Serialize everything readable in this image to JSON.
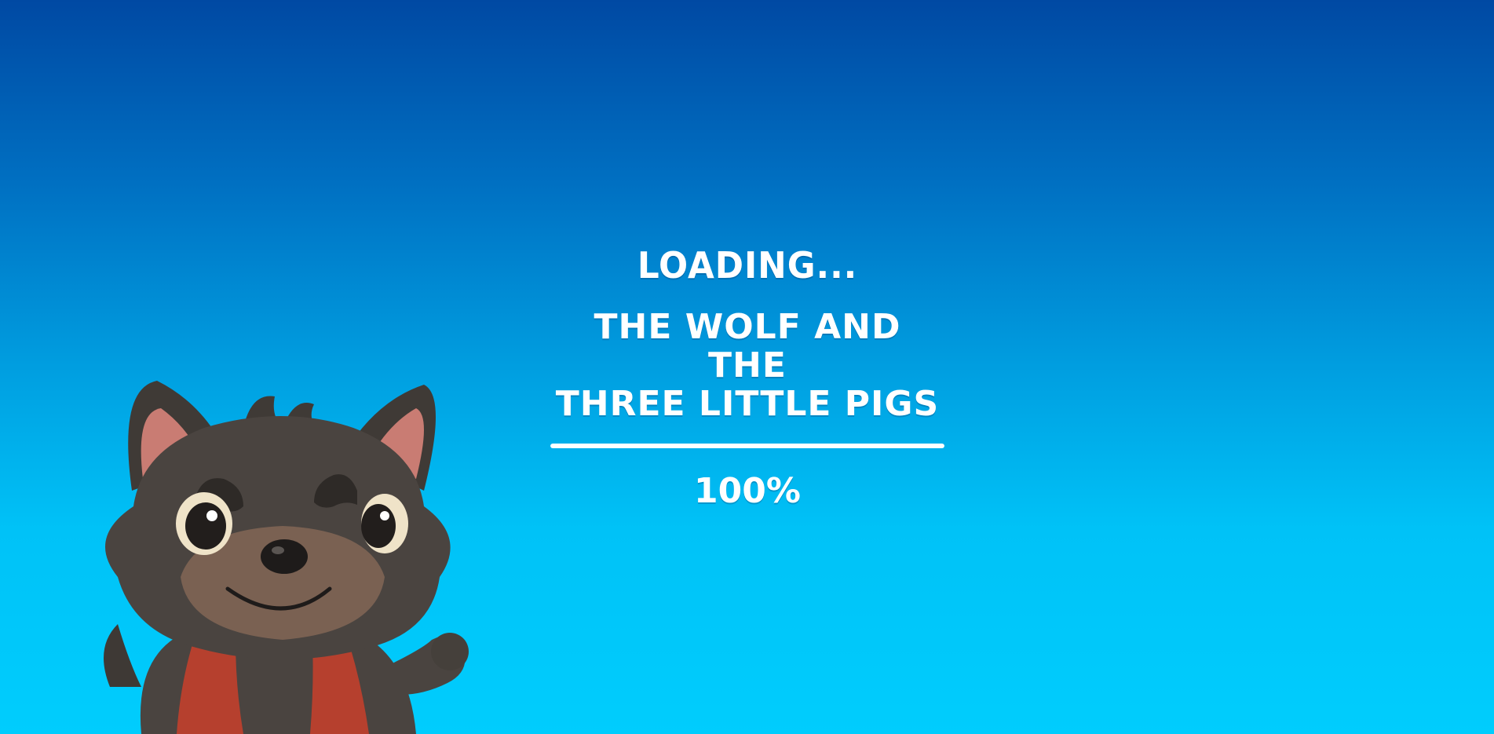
{
  "loading": {
    "label": "LOADING..."
  },
  "game": {
    "title_line1": "THE WOLF AND THE",
    "title_line2": "THREE LITTLE PIGS"
  },
  "progress": {
    "value": 1.0,
    "percent_text": "100%"
  },
  "mascot": {
    "icon": "wolf-character"
  },
  "colors": {
    "background_top": "#0049a3",
    "background_bottom": "#00cdfd",
    "text": "#ffffff",
    "wolf_fur": "#4a4440",
    "wolf_vest": "#b6402e"
  }
}
